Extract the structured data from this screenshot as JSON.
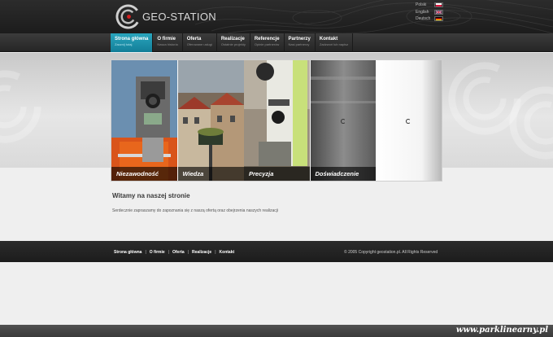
{
  "header": {
    "logo_text": "GEO-STATION",
    "languages": [
      {
        "label": "Polski",
        "flag": "pl-flag-icon"
      },
      {
        "label": "English",
        "flag": "uk-flag-icon"
      },
      {
        "label": "Deutsch",
        "flag": "de-flag-icon"
      }
    ]
  },
  "nav": {
    "items": [
      {
        "label": "Strona główna",
        "sub": "Zacznij tutaj",
        "active": true
      },
      {
        "label": "O firmie",
        "sub": "Nasza historia"
      },
      {
        "label": "Oferta",
        "sub": "Oferowane usługi"
      },
      {
        "label": "Realizacje",
        "sub": "Ostatnie projekty"
      },
      {
        "label": "Referencje",
        "sub": "Opinie partnerów"
      },
      {
        "label": "Partnerzy",
        "sub": "Nasi partnerzy"
      },
      {
        "label": "Kontakt",
        "sub": "Zadzwoń lub napisz"
      }
    ]
  },
  "slider": {
    "captions": [
      "Niezawodność",
      "Wiedza",
      "Precyzja",
      "Doświadczenie"
    ]
  },
  "content": {
    "title": "Witamy na naszej stronie",
    "text": "Serdecznie zapraszamy do zapoznania się z naszą ofertą oraz obejrzenia naszych realizacji"
  },
  "footer": {
    "links": [
      "Strona główna",
      "O firmie",
      "Oferta",
      "Realizacje",
      "Kontakt"
    ],
    "separator": "|",
    "copyright": "© 2005 Copyright geostation.pl. All Rights Reserved"
  },
  "watermark": "www.parklinearny.pl",
  "colors": {
    "accent": "#1b93ad",
    "header_bg": "#232323",
    "footer_bg": "#232323",
    "page_bg": "#efefef"
  }
}
